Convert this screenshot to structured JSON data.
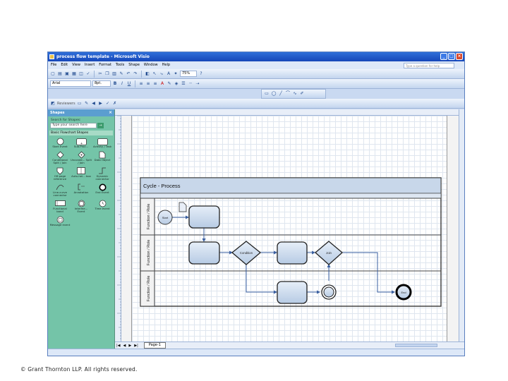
{
  "window": {
    "title": "process flow template - Microsoft Visio"
  },
  "menu": {
    "items": [
      "File",
      "Edit",
      "View",
      "Insert",
      "Format",
      "Tools",
      "Shape",
      "Window",
      "Help"
    ],
    "help_placeholder": "Type a question for help"
  },
  "toolbar": {
    "zoom": "75%",
    "font": "Arial",
    "font_size": "8pt.",
    "reviewers_label": "Reviewers"
  },
  "shapes_panel": {
    "title": "Shapes",
    "search_label": "Search for Shapes:",
    "search_placeholder": "Type your search here",
    "stencil": "Basic Flowchart Shapes",
    "items": [
      "Start Event",
      "Sub-Proc...",
      "Activity / Task",
      "Conditional Split / Join",
      "Unconde... Split / Join",
      "Data Object",
      "Off-page reference",
      "Auto-hei... box",
      "Dynamic connector",
      "Line-curve connector",
      "Annotation",
      "End Event",
      "Functional band",
      "Interme... Event",
      "Time event",
      "Message event"
    ]
  },
  "diagram": {
    "title": "Cycle - Process",
    "lanes": [
      "Function / Role",
      "Function / Role",
      "Function / Role"
    ],
    "start_label": "Start",
    "condition_label": "Condition",
    "join_label": "Join",
    "end_label": "End"
  },
  "tabs": {
    "page": "Page-1"
  },
  "footer": {
    "copyright": "© Grant Thornton LLP. All rights reserved."
  }
}
